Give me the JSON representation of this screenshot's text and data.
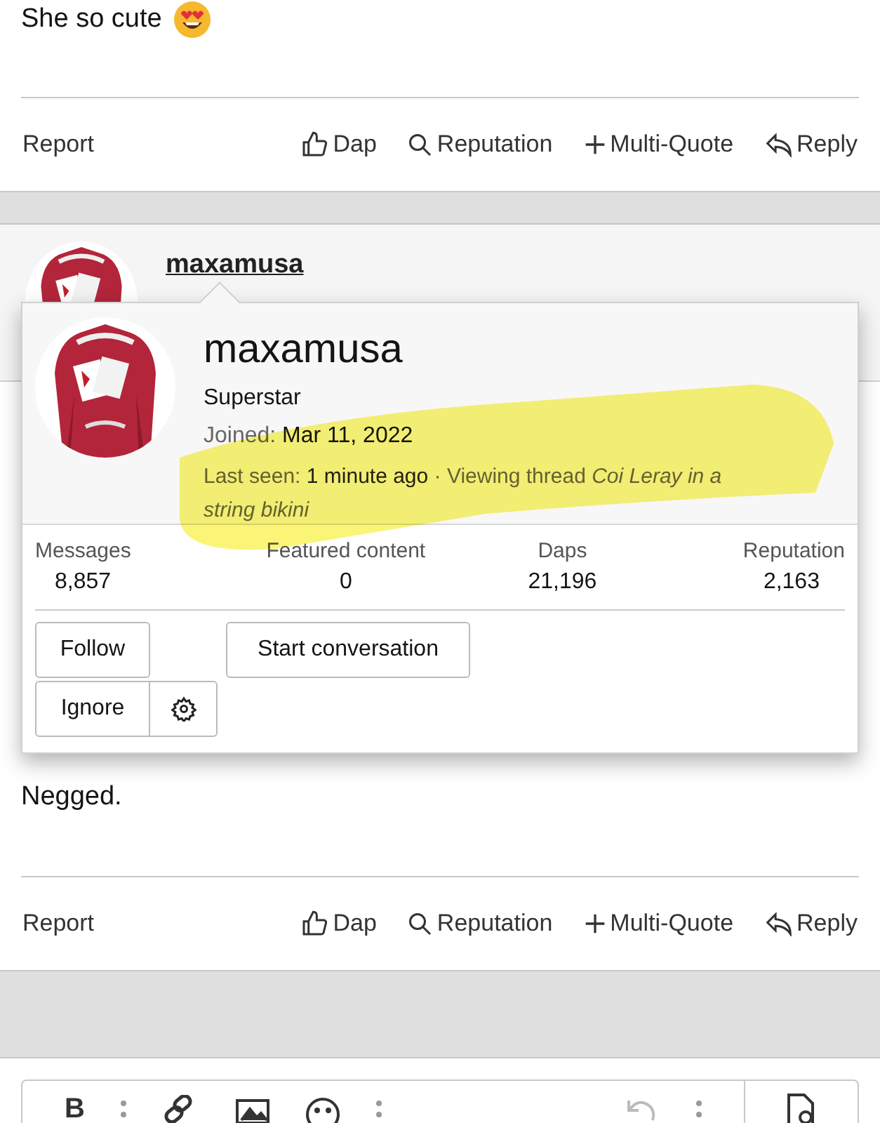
{
  "posts": [
    {
      "body_lines": [
        "She so cute"
      ],
      "emoji": true,
      "actions": [
        "Report",
        "Dap",
        "Reputation",
        "Multi-Quote",
        "Reply"
      ]
    },
    {
      "author": "maxamusa",
      "body_lines": [
        "Negged."
      ],
      "emoji": false,
      "actions": [
        "Report",
        "Dap",
        "Reputation",
        "Multi-Quote",
        "Reply"
      ]
    }
  ],
  "member_card": {
    "name": "maxamusa",
    "title": "Superstar",
    "joined_label": "Joined:",
    "joined": "Mar 11, 2022",
    "last_seen_label": "Last seen:",
    "last_seen": "1 minute ago",
    "activity": "· Viewing thread *Coi Leray in a string bikini*",
    "stats": [
      {
        "label": "Messages",
        "value": "8,857"
      },
      {
        "label": "Featured content",
        "value": "0"
      },
      {
        "label": "Daps",
        "value": "21,196"
      },
      {
        "label": "Reputation",
        "value": "2,163"
      }
    ],
    "buttons": [
      "Follow",
      "Start conversation",
      "Ignore"
    ],
    "highlighted": true
  },
  "editor": {
    "bold": "B"
  }
}
